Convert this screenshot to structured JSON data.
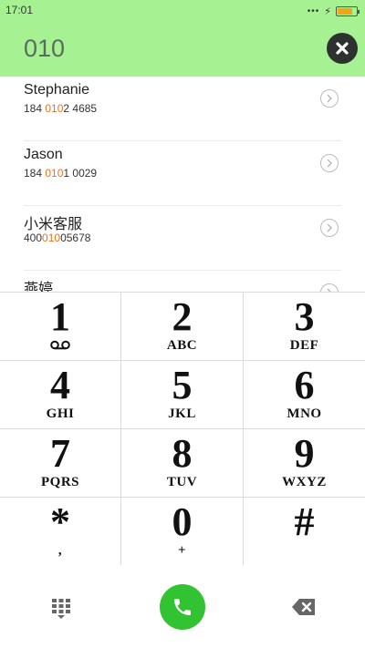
{
  "status_bar": {
    "time": "17:01",
    "signal_dots": "•••",
    "battery_level_percent": 80
  },
  "dialer": {
    "dialed_number": "010"
  },
  "contacts": [
    {
      "name": "Stephanie",
      "number_parts": [
        "184 ",
        "010",
        "2 4685"
      ]
    },
    {
      "name": "Jason",
      "number_parts": [
        "184 ",
        "010",
        "1 0029"
      ]
    },
    {
      "name": "小米客服",
      "number_parts": [
        "400",
        "010",
        "05678"
      ]
    },
    {
      "name": "燕婷",
      "number_parts": [
        "",
        "",
        ""
      ]
    }
  ],
  "keypad": {
    "keys": [
      {
        "digit": "1",
        "letters": ""
      },
      {
        "digit": "2",
        "letters": "ABC"
      },
      {
        "digit": "3",
        "letters": "DEF"
      },
      {
        "digit": "4",
        "letters": "GHI"
      },
      {
        "digit": "5",
        "letters": "JKL"
      },
      {
        "digit": "6",
        "letters": "MNO"
      },
      {
        "digit": "7",
        "letters": "PQRS"
      },
      {
        "digit": "8",
        "letters": "TUV"
      },
      {
        "digit": "9",
        "letters": "WXYZ"
      },
      {
        "digit": "*",
        "letters": ","
      },
      {
        "digit": "0",
        "letters": "+"
      },
      {
        "digit": "#",
        "letters": ""
      }
    ]
  },
  "icons": {
    "clear": "close-icon",
    "dialpad": "dialpad-icon",
    "call": "phone-icon",
    "backspace": "backspace-icon",
    "voicemail": "voicemail-icon",
    "chevron": "chevron-right-icon"
  },
  "colors": {
    "header_bg": "#a6f292",
    "highlight": "#e8741d",
    "call_button": "#32c332",
    "battery": "#f7a21b"
  }
}
